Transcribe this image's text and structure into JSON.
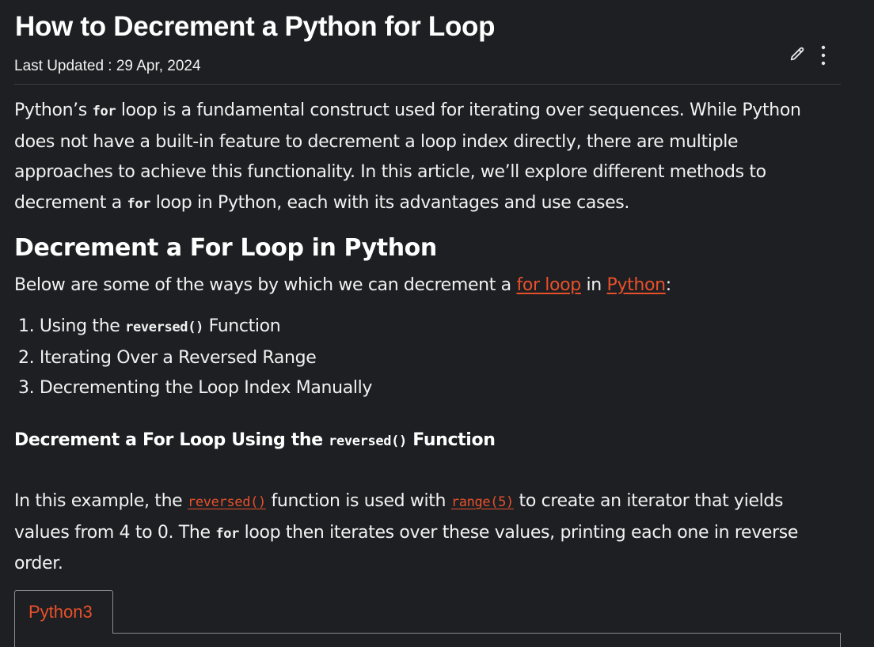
{
  "article": {
    "title": "How to Decrement a Python for Loop",
    "last_updated": "Last Updated : 29 Apr, 2024"
  },
  "toolbar": {
    "edit_icon": "pencil-icon",
    "more_icon": "vertical-dots-icon"
  },
  "intro": {
    "part1": "Python’s ",
    "code1": "for",
    "part2": " loop is a fundamental construct used for iterating over sequences. While Python does not have a built-in feature to decrement a loop index directly, there are multiple approaches to achieve this functionality. In this article, we’ll explore different methods to decrement a ",
    "code2": "for",
    "part3": " loop in Python, each with its advantages and use cases."
  },
  "section": {
    "heading": "Decrement a For Loop in Python",
    "lead_part1": "Below are some of the ways by which we can decrement a ",
    "link_for_loop": "for loop",
    "lead_part2": " in ",
    "link_python": "Python",
    "lead_part3": ":",
    "methods": [
      {
        "prefix": "1. Using the ",
        "code": "reversed()",
        "suffix": " Function"
      },
      {
        "text": "2. Iterating Over a Reversed Range"
      },
      {
        "text": "3. Decrementing the Loop Index Manually"
      }
    ]
  },
  "subsection": {
    "heading_part1": "Decrement a For Loop Using the ",
    "heading_code": "reversed()",
    "heading_part2": " Function",
    "body_part1": "In this example, the ",
    "link_reversed": "reversed()",
    "body_part2": " function is used with ",
    "link_range": "range(5)",
    "body_part3": " to create an iterator that yields values from 4 to 0. The ",
    "body_code": "for",
    "body_part4": " loop then iterates over these values, printing each one in reverse order."
  },
  "code_tabs": [
    {
      "label": "Python3"
    }
  ],
  "colors": {
    "background": "#1d1f23",
    "text": "#f2f2f2",
    "link": "#e8502a",
    "divider": "#3a3c41"
  }
}
